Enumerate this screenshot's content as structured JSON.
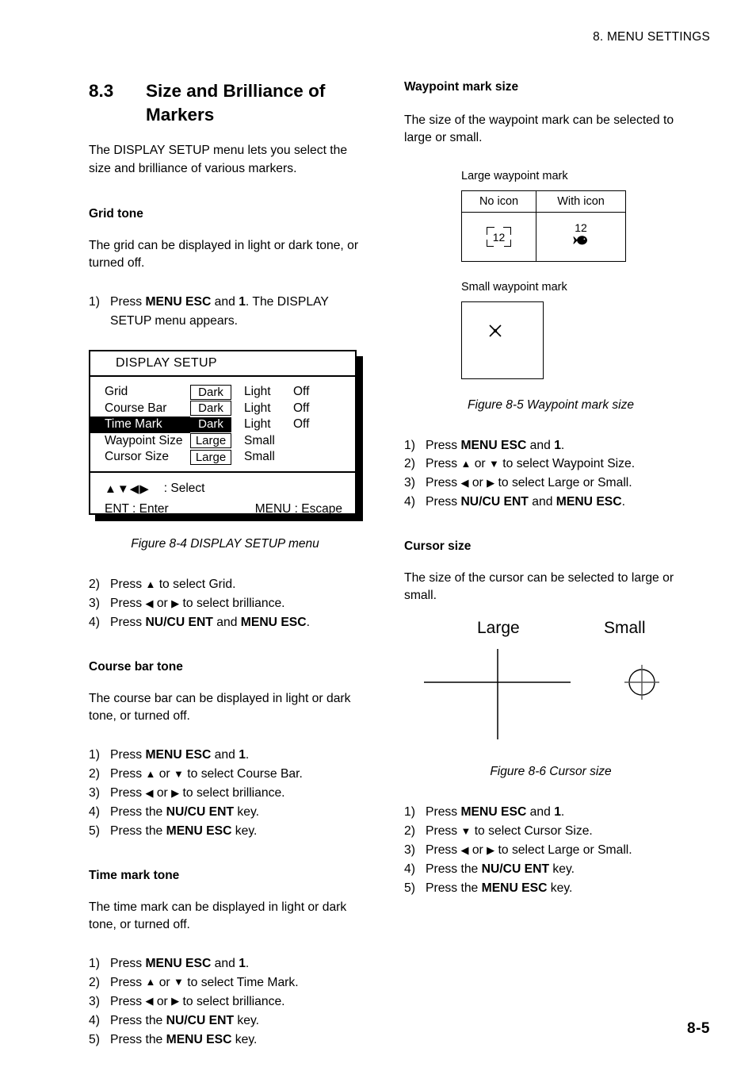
{
  "header": {
    "running_head": "8. MENU SETTINGS"
  },
  "footer": {
    "page_number": "8-5"
  },
  "section": {
    "number": "8.3",
    "title": "Size and Brilliance of Markers",
    "intro": "The DISPLAY SETUP menu lets you select the size and brilliance of various markers."
  },
  "grid_tone": {
    "heading": "Grid tone",
    "body": "The grid can be displayed in light or dark tone, or turned off.",
    "step1_num": "1)",
    "step1_a": "Press ",
    "step1_b1": "MENU ESC",
    "step1_c": " and ",
    "step1_b2": "1",
    "step1_d": ". The DISPLAY SETUP menu appears.",
    "steps_after": [
      {
        "num": "2)",
        "pre": "Press ",
        "icon": "up-arrow",
        "post": " to select Grid."
      },
      {
        "num": "3)",
        "pre": "Press ",
        "icon": "left-right-arrow",
        "post": " to select brilliance."
      },
      {
        "num": "4)",
        "pre": "Press ",
        "bold1": "NU/CU ENT",
        "mid": " and ",
        "bold2": "MENU ESC",
        "post": "."
      }
    ]
  },
  "display_setup_menu": {
    "title": "DISPLAY SETUP",
    "rows": [
      {
        "label": "Grid",
        "selected": false,
        "options": [
          "Dark",
          "Light",
          "Off"
        ],
        "value_index": 0
      },
      {
        "label": "Course Bar",
        "selected": false,
        "options": [
          "Dark",
          "Light",
          "Off"
        ],
        "value_index": 0
      },
      {
        "label": "Time Mark",
        "selected": true,
        "options": [
          "Dark",
          "Light",
          "Off"
        ],
        "value_index": 0
      },
      {
        "label": "Waypoint Size",
        "selected": false,
        "options": [
          "Large",
          "Small"
        ],
        "value_index": 0
      },
      {
        "label": "Cursor Size",
        "selected": false,
        "options": [
          "Large",
          "Small"
        ],
        "value_index": 0
      }
    ],
    "footer": {
      "arrows": "▲▼◀▶",
      "select_label": ": Select",
      "enter_label": "ENT : Enter",
      "escape_label": "MENU : Escape"
    },
    "caption": "Figure 8-4 DISPLAY SETUP menu"
  },
  "course_bar_tone": {
    "heading": "Course bar tone",
    "body": "The course bar can be displayed in light or dark tone, or turned off.",
    "steps": [
      {
        "num": "1)",
        "pre": "Press ",
        "bold1": "MENU ESC",
        "mid": " and ",
        "bold2": "1",
        "post": "."
      },
      {
        "num": "2)",
        "pre": "Press ",
        "icon": "up-down-arrow",
        "post": " to select Course Bar."
      },
      {
        "num": "3)",
        "pre": "Press ",
        "icon": "left-right-arrow",
        "post": " to select brilliance."
      },
      {
        "num": "4)",
        "pre": "Press the ",
        "bold1": "NU/CU ENT",
        "post": " key."
      },
      {
        "num": "5)",
        "pre": "Press the ",
        "bold1": "MENU ESC",
        "post": " key."
      }
    ]
  },
  "time_mark_tone": {
    "heading": "Time mark tone",
    "body": "The time mark can be displayed in light or dark tone, or turned off.",
    "steps": [
      {
        "num": "1)",
        "pre": "Press ",
        "bold1": "MENU ESC",
        "mid": " and ",
        "bold2": "1",
        "post": "."
      },
      {
        "num": "2)",
        "pre": "Press ",
        "icon": "up-down-arrow",
        "post": " to select Time Mark."
      },
      {
        "num": "3)",
        "pre": "Press ",
        "icon": "left-right-arrow",
        "post": " to select brilliance."
      },
      {
        "num": "4)",
        "pre": "Press the ",
        "bold1": "NU/CU ENT",
        "post": " key."
      },
      {
        "num": "5)",
        "pre": "Press the ",
        "bold1": "MENU ESC",
        "post": " key."
      }
    ]
  },
  "waypoint_mark_size": {
    "heading": "Waypoint mark size",
    "body": "The size of the waypoint mark can be selected to large or small.",
    "large_label": "Large waypoint mark",
    "table": {
      "headers": [
        "No icon",
        "With icon"
      ],
      "no_icon_value": "12",
      "with_icon_value": "12",
      "with_icon_glyph": "fish-icon"
    },
    "small_label": "Small waypoint mark",
    "small_glyph": "x-cross-icon",
    "caption": "Figure 8-5 Waypoint mark size",
    "steps": [
      {
        "num": "1)",
        "pre": "Press ",
        "bold1": "MENU ESC",
        "mid": " and ",
        "bold2": "1",
        "post": "."
      },
      {
        "num": "2)",
        "pre": "Press ",
        "icon": "up-down-arrow",
        "post": " to select Waypoint Size."
      },
      {
        "num": "3)",
        "pre": "Press ",
        "icon": "left-right-arrow",
        "post": " to select Large or Small."
      },
      {
        "num": "4)",
        "pre": "Press ",
        "bold1": "NU/CU ENT",
        "mid": " and ",
        "bold2": "MENU ESC",
        "post": "."
      }
    ]
  },
  "cursor_size": {
    "heading": "Cursor size",
    "body": "The size of the cursor can be selected to large or small.",
    "large_label": "Large",
    "small_label": "Small",
    "caption": "Figure 8-6 Cursor size",
    "steps": [
      {
        "num": "1)",
        "pre": "Press ",
        "bold1": "MENU ESC",
        "mid": " and ",
        "bold2": "1",
        "post": "."
      },
      {
        "num": "2)",
        "pre": "Press ",
        "icon": "down-arrow",
        "post": " to select Cursor Size."
      },
      {
        "num": "3)",
        "pre": "Press ",
        "icon": "left-right-arrow",
        "post": " to select Large or Small."
      },
      {
        "num": "4)",
        "pre": "Press the ",
        "bold1": "NU/CU ENT",
        "post": " key."
      },
      {
        "num": "5)",
        "pre": "Press the ",
        "bold1": "MENU ESC",
        "post": " key."
      }
    ]
  },
  "colors": {
    "ink": "#000000",
    "paper": "#ffffff"
  }
}
